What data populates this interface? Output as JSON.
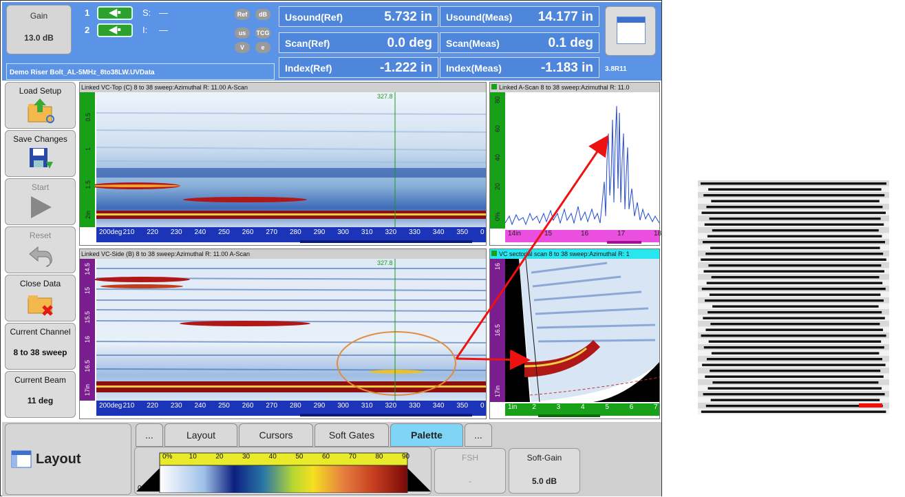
{
  "gain": {
    "label": "Gain",
    "value": "13.0 dB"
  },
  "probes": [
    {
      "number": "1",
      "field": "S:",
      "value": "—"
    },
    {
      "number": "2",
      "field": "I:",
      "value": "—"
    }
  ],
  "pills": [
    "Ref",
    "dB",
    "us",
    "TCG",
    "V",
    "e"
  ],
  "readings": [
    {
      "label": "Usound(Ref)",
      "value": "5.732 in"
    },
    {
      "label": "Usound(Meas)",
      "value": "14.177 in"
    },
    {
      "label": "Scan(Ref)",
      "value": "0.0 deg"
    },
    {
      "label": "Scan(Meas)",
      "value": "0.1 deg"
    },
    {
      "label": "Index(Ref)",
      "value": "-1.222 in"
    },
    {
      "label": "Index(Meas)",
      "value": "-1.183 in"
    }
  ],
  "file_name": "Demo Riser Bolt_AL-5MHz_8to38LW.UVData",
  "version": "3.8R11",
  "sidebar": [
    {
      "label": "Load Setup",
      "icon": "folder-open-icon"
    },
    {
      "label": "Save Changes",
      "icon": "floppy-disk-icon"
    },
    {
      "label": "Start",
      "icon": "play-icon"
    },
    {
      "label": "Reset",
      "icon": "undo-icon"
    },
    {
      "label": "Close Data",
      "icon": "folder-close-icon"
    }
  ],
  "current_channel": {
    "label": "Current Channel",
    "value": "8 to 38 sweep"
  },
  "current_beam": {
    "label": "Current Beam",
    "value": "11 deg"
  },
  "views": {
    "top": {
      "title": "Linked VC-Top (C) 8 to 38 sweep:Azimuthal   R: 11.00 A-Scan",
      "cursor": "327.8",
      "y_ticks": [
        "0.5",
        "1",
        "1.5",
        "2in"
      ],
      "x_ticks": [
        "200deg",
        "210",
        "220",
        "230",
        "240",
        "250",
        "260",
        "270",
        "280",
        "290",
        "300",
        "310",
        "320",
        "330",
        "340",
        "350",
        "0"
      ]
    },
    "side": {
      "title": "Linked VC-Side (B) 8 to 38 sweep:Azimuthal   R: 11.00 A-Scan",
      "cursor": "327.8",
      "y_ticks": [
        "14.5",
        "15",
        "15.5",
        "16",
        "16.5",
        "17in"
      ],
      "x_ticks": [
        "200deg",
        "210",
        "220",
        "230",
        "240",
        "250",
        "260",
        "270",
        "280",
        "290",
        "300",
        "310",
        "320",
        "330",
        "340",
        "350",
        "0"
      ]
    },
    "ascan": {
      "title": "Linked A-Scan 8 to 38 sweep:Azimuthal   R: 11.0",
      "y_ticks": [
        "0%",
        "20",
        "40",
        "60",
        "80"
      ],
      "x_ticks": [
        "14in",
        "15",
        "16",
        "17",
        "18"
      ]
    },
    "sector": {
      "title": "VC sectorial scan 8 to 38 sweep:Azimuthal   R: 1",
      "y_ticks": [
        "16",
        "16.5",
        "17in"
      ],
      "x_ticks": [
        "1in",
        "2",
        "3",
        "4",
        "5",
        "6",
        "7"
      ]
    }
  },
  "bottom": {
    "mode_label": "Layout",
    "mode_icon": "layout-icon"
  },
  "tabs": [
    "...",
    "Layout",
    "Cursors",
    "Soft Gates",
    "Palette",
    "..."
  ],
  "active_tab": "Palette",
  "palette": {
    "ticks": [
      "0%",
      "10",
      "20",
      "30",
      "40",
      "50",
      "60",
      "70",
      "80",
      "90"
    ],
    "min": "0.0",
    "max": "100.0"
  },
  "fsh": {
    "label": "FSH",
    "value": "-"
  },
  "soft_gain": {
    "label": "Soft-Gain",
    "value": "5.0 dB"
  },
  "colors": {
    "topbar": "#5b94e6",
    "palette_band": "#7fd5f5",
    "ruler_green": "#19a019",
    "ruler_purple": "#7a1d8e",
    "ruler_magenta": "#ea4fe0",
    "ruler_blue": "#1c34b8",
    "annotation_red": "#ee1111",
    "annotation_orange": "#e68a3d"
  }
}
